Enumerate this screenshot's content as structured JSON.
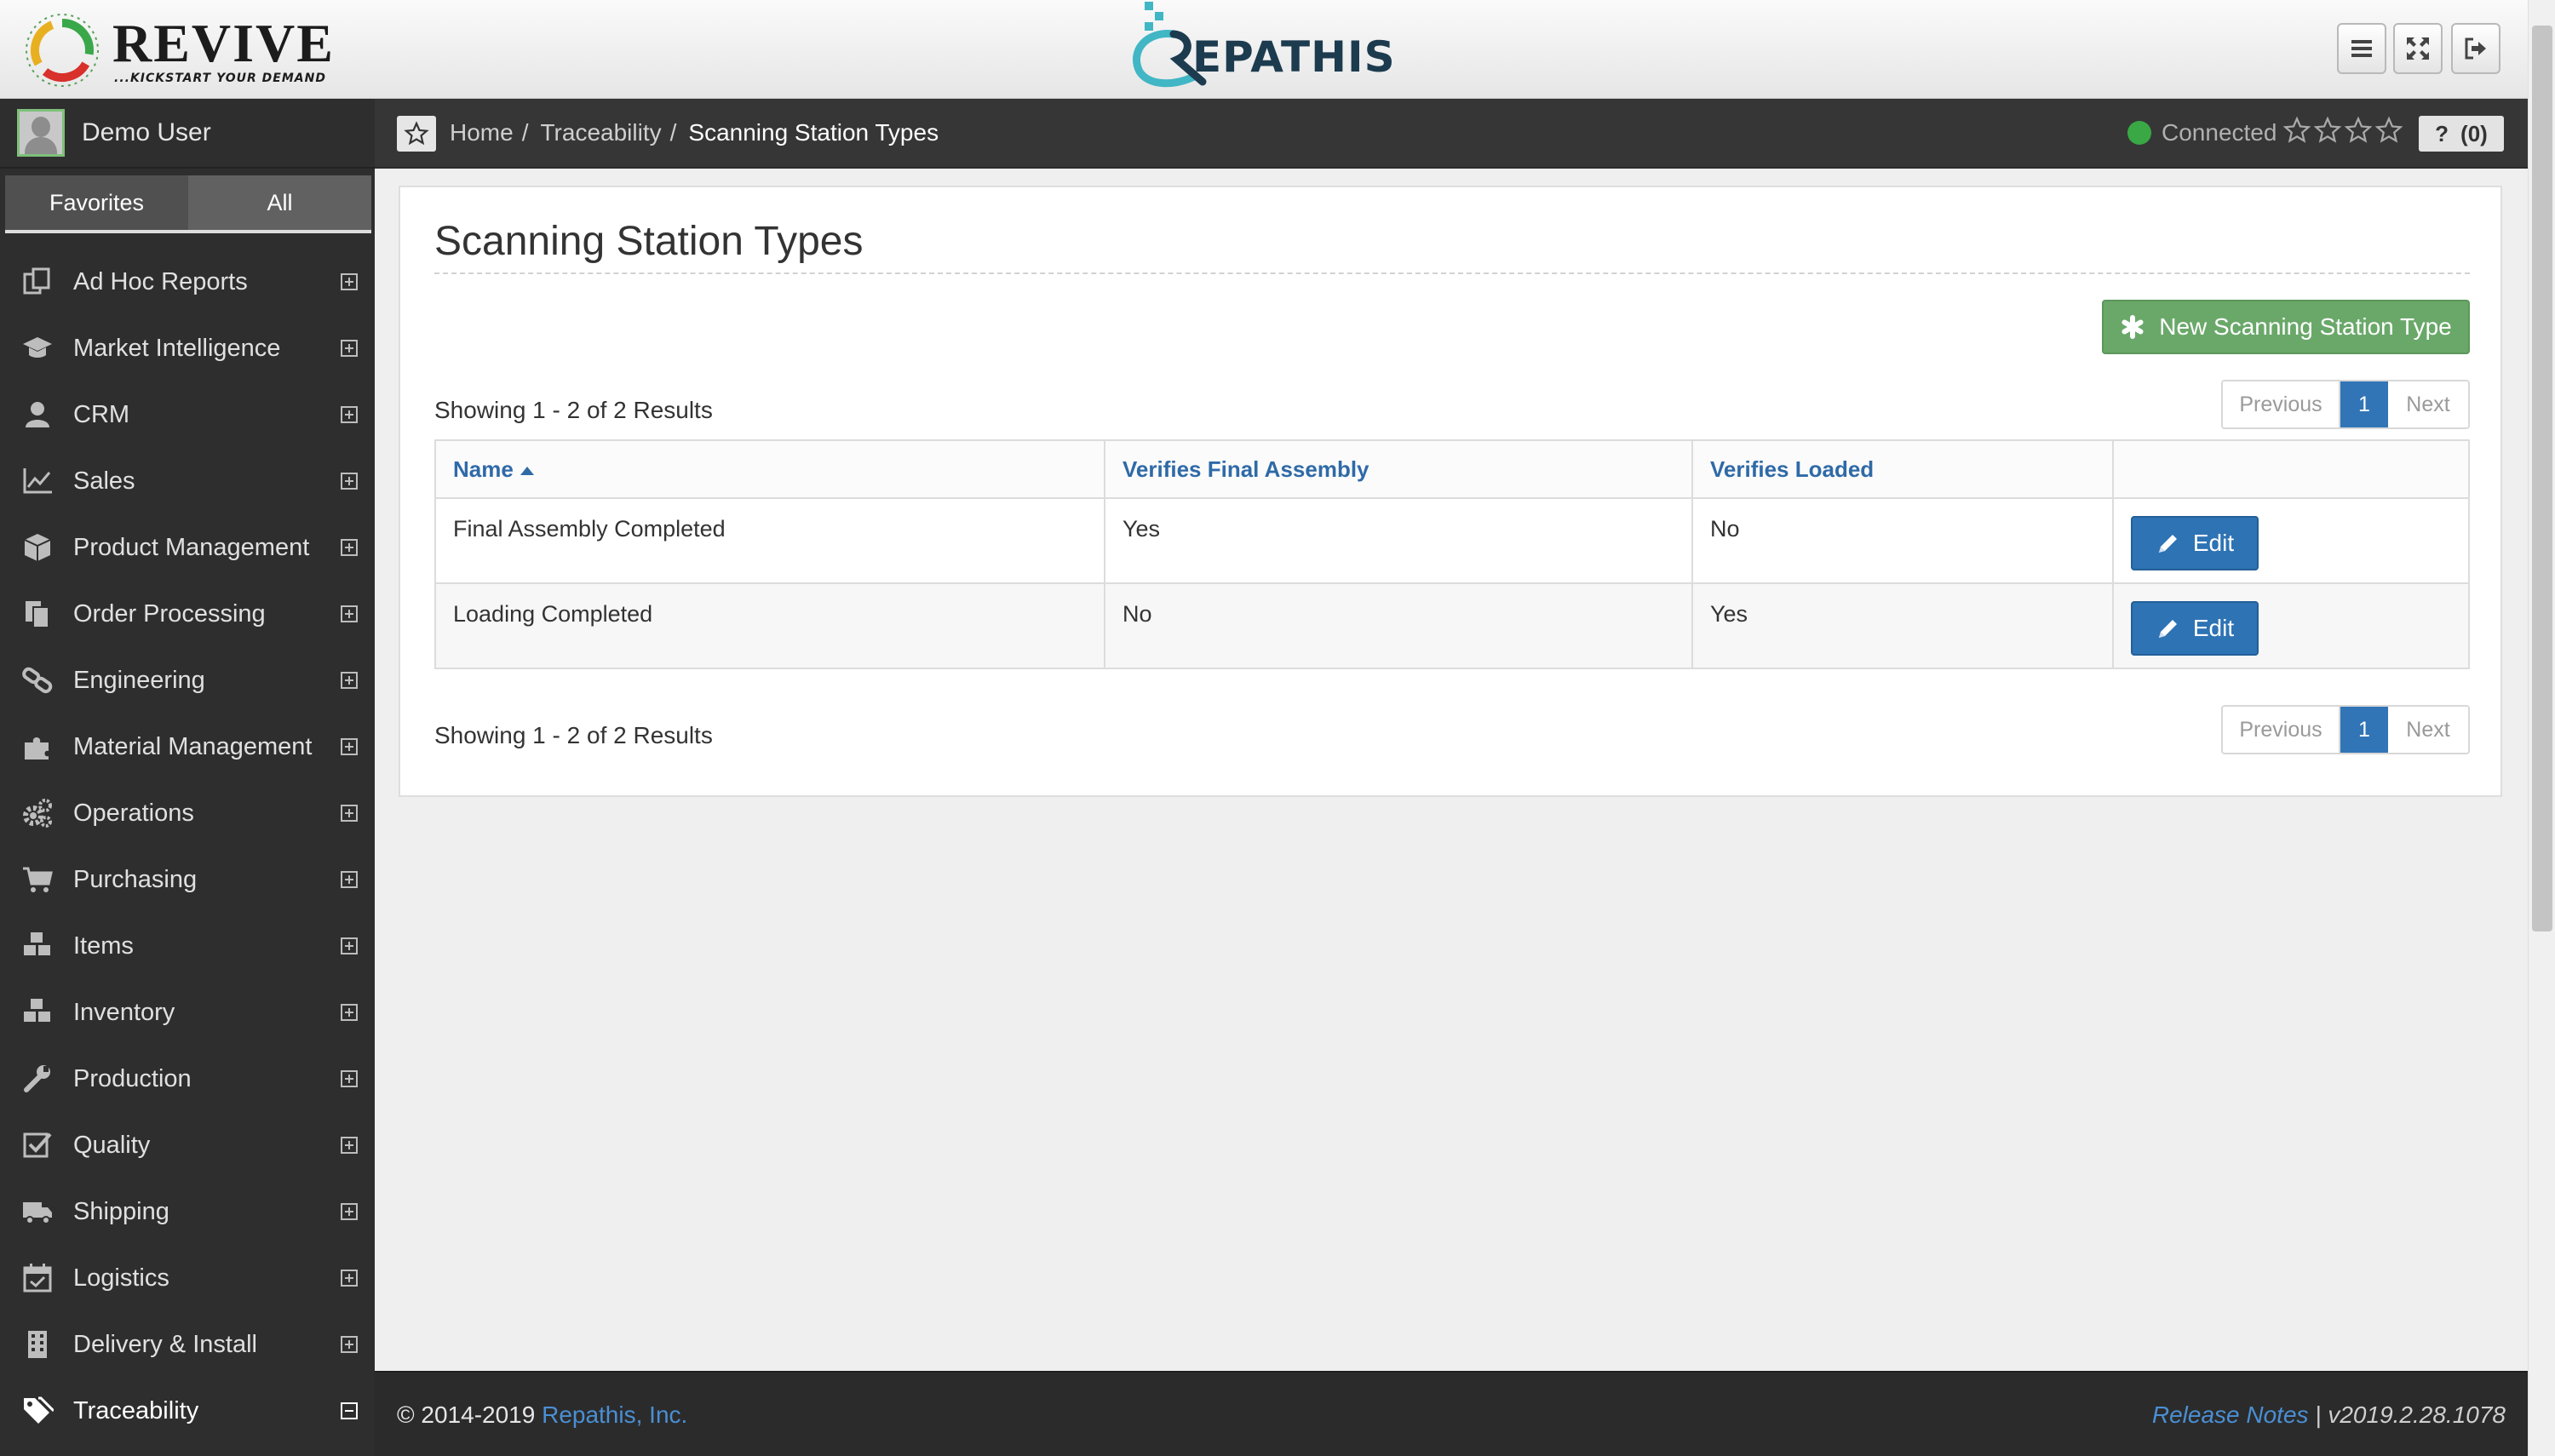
{
  "header": {
    "brand_left": {
      "name": "REVIVE",
      "tagline": "...KICKSTART YOUR DEMAND"
    },
    "brand_center": {
      "name": "EPATHIS"
    },
    "buttons": [
      {
        "name": "menu-toggle-button",
        "icon": "hamburger-icon"
      },
      {
        "name": "fullscreen-button",
        "icon": "expand-arrows-icon"
      },
      {
        "name": "logout-button",
        "icon": "sign-out-icon"
      }
    ]
  },
  "sidebar": {
    "user_name": "Demo User",
    "tabs": {
      "favorites": "Favorites",
      "all": "All"
    },
    "items": [
      {
        "label": "Ad Hoc Reports",
        "icon": "copy-icon"
      },
      {
        "label": "Market Intelligence",
        "icon": "graduation-cap-icon"
      },
      {
        "label": "CRM",
        "icon": "user-icon"
      },
      {
        "label": "Sales",
        "icon": "line-chart-icon"
      },
      {
        "label": "Product Management",
        "icon": "cube-icon"
      },
      {
        "label": "Order Processing",
        "icon": "files-icon"
      },
      {
        "label": "Engineering",
        "icon": "link-icon"
      },
      {
        "label": "Material Management",
        "icon": "puzzle-icon"
      },
      {
        "label": "Operations",
        "icon": "gears-icon"
      },
      {
        "label": "Purchasing",
        "icon": "shopping-cart-icon"
      },
      {
        "label": "Items",
        "icon": "cubes-icon"
      },
      {
        "label": "Inventory",
        "icon": "cubes-icon"
      },
      {
        "label": "Production",
        "icon": "wrench-icon"
      },
      {
        "label": "Quality",
        "icon": "check-square-icon"
      },
      {
        "label": "Shipping",
        "icon": "truck-icon"
      },
      {
        "label": "Logistics",
        "icon": "calendar-check-icon"
      },
      {
        "label": "Delivery & Install",
        "icon": "building-icon"
      },
      {
        "label": "Traceability",
        "icon": "tags-icon",
        "active": true
      }
    ]
  },
  "breadcrumb": {
    "items": [
      "Home",
      "Traceability"
    ],
    "current": "Scanning Station Types",
    "status": "Connected",
    "help_count": "(0)"
  },
  "main": {
    "title": "Scanning Station Types",
    "new_button_label": "New Scanning Station Type",
    "results_text": "Showing 1 - 2 of 2 Results",
    "pager": {
      "previous": "Previous",
      "page": "1",
      "next": "Next"
    },
    "columns": [
      "Name",
      "Verifies Final Assembly",
      "Verifies Loaded"
    ],
    "rows": [
      {
        "name": "Final Assembly Completed",
        "verifies_final_assembly": "Yes",
        "verifies_loaded": "No"
      },
      {
        "name": "Loading Completed",
        "verifies_final_assembly": "No",
        "verifies_loaded": "Yes"
      }
    ],
    "edit_label": "Edit"
  },
  "footer": {
    "copyright": "© 2014-2019",
    "company_link": "Repathis, Inc.",
    "release_notes": "Release Notes",
    "separator": "|",
    "version": "v2019.2.28.1078"
  },
  "colors": {
    "accent_blue": "#2e73b4",
    "success_green": "#6aa86a",
    "connected_dot": "#39a845",
    "sidebar_bg": "#2e2e2e"
  }
}
